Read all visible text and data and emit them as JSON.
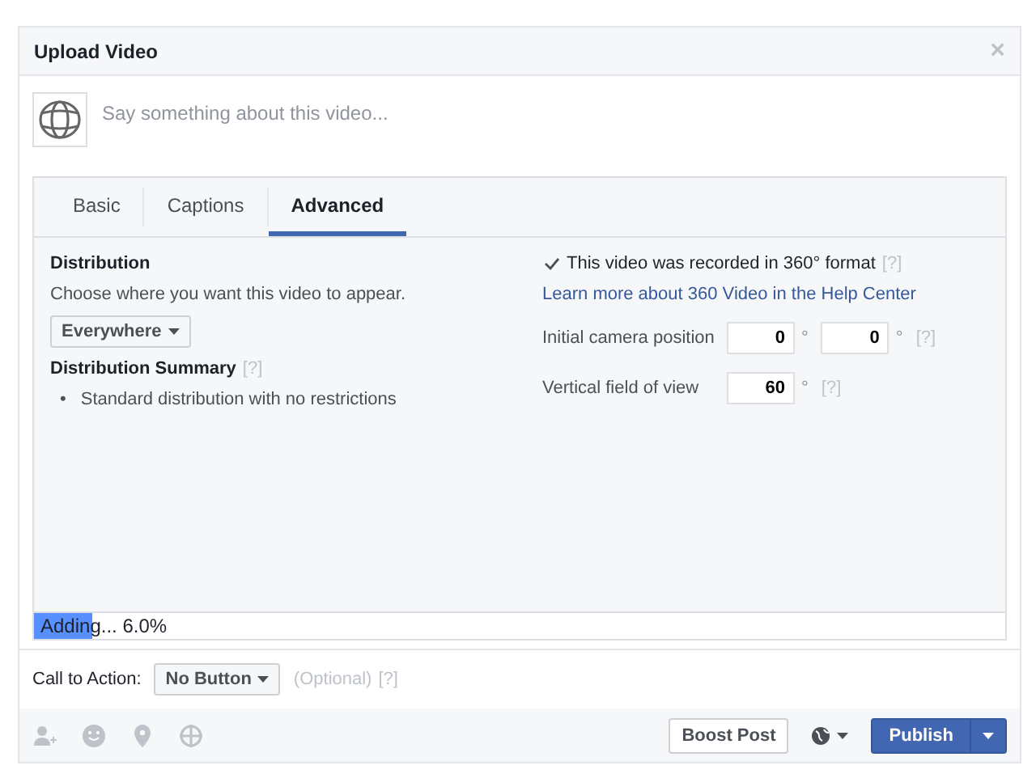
{
  "dialog": {
    "title": "Upload Video",
    "close": "×"
  },
  "composer": {
    "placeholder": "Say something about this video..."
  },
  "tabs": [
    {
      "label": "Basic",
      "selected": false
    },
    {
      "label": "Captions",
      "selected": false
    },
    {
      "label": "Advanced",
      "selected": true
    }
  ],
  "distribution": {
    "heading": "Distribution",
    "description": "Choose where you want this video to appear.",
    "dropdown": "Everywhere",
    "summary_heading": "Distribution Summary",
    "summary_help": "[?]",
    "summary_items": [
      {
        "bullet": "•",
        "text": "Standard distribution with no restrictions"
      }
    ]
  },
  "video_360": {
    "checkbox_label": "This video was recorded in 360° format",
    "checked": true,
    "help": "[?]",
    "link": "Learn more about 360 Video in the Help Center",
    "fields": [
      {
        "label": "Initial camera position",
        "values": [
          "0",
          "0"
        ],
        "unit": "°",
        "help": "[?]"
      },
      {
        "label": "Vertical field of view",
        "values": [
          "60"
        ],
        "unit": "°",
        "help": "[?]"
      }
    ]
  },
  "progress": {
    "text": "Adding... 6.0%",
    "level": 0.06
  },
  "call_to_action": {
    "label": "Call to Action:",
    "dropdown": "No Button",
    "optional": "(Optional)",
    "help": "[?]"
  },
  "footer": {
    "boost": "Boost Post",
    "publish": "Publish"
  }
}
